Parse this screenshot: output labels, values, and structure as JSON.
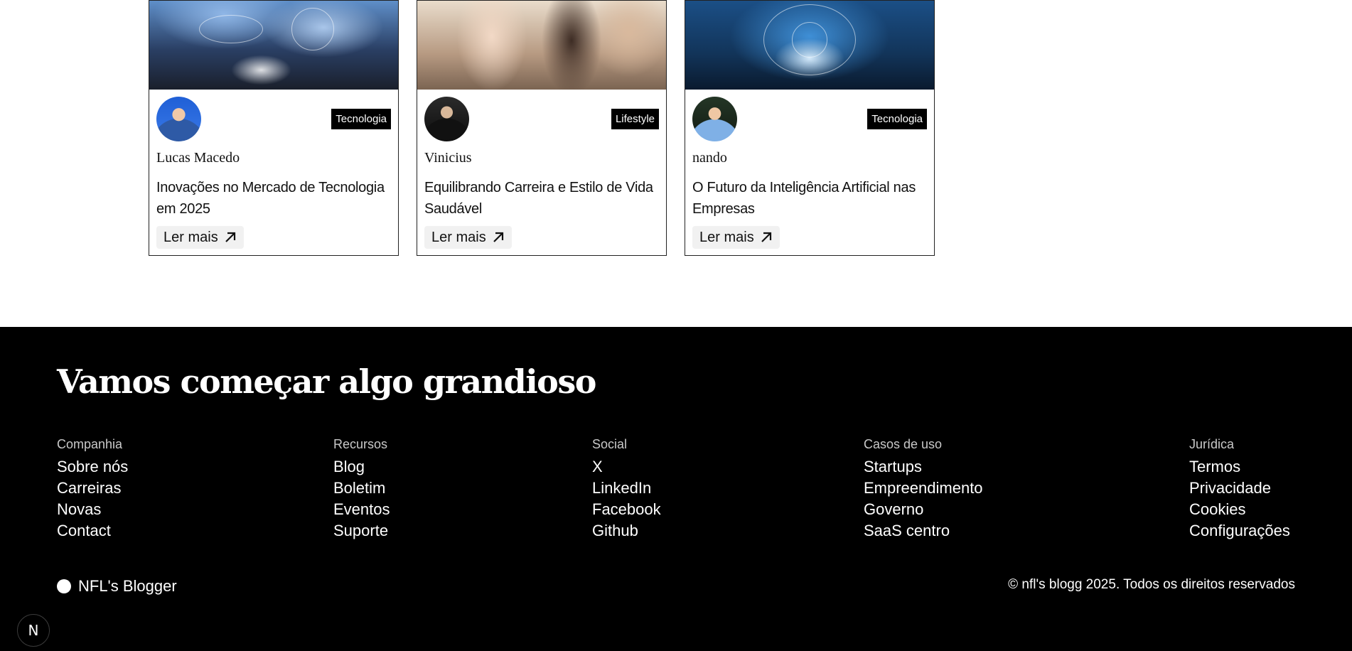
{
  "cards": [
    {
      "category": "Tecnologia",
      "author": "Lucas Macedo",
      "title": "Inovações no Mercado de Tecnologia em 2025",
      "read_more": "Ler mais"
    },
    {
      "category": "Lifestyle",
      "author": "Vinicius",
      "title": "Equilibrando Carreira e Estilo de Vida Saudável",
      "read_more": "Ler mais"
    },
    {
      "category": "Tecnologia",
      "author": "nando",
      "title": "O Futuro da Inteligência Artificial nas Empresas",
      "read_more": "Ler mais"
    }
  ],
  "footer": {
    "headline": "Vamos começar algo grandioso",
    "columns": [
      {
        "heading": "Companhia",
        "links": [
          "Sobre nós",
          "Carreiras",
          "Novas",
          "Contact"
        ]
      },
      {
        "heading": "Recursos",
        "links": [
          "Blog",
          "Boletim",
          "Eventos",
          "Suporte"
        ]
      },
      {
        "heading": "Social",
        "links": [
          "X",
          "LinkedIn",
          "Facebook",
          "Github"
        ]
      },
      {
        "heading": "Casos de uso",
        "links": [
          "Startups",
          "Empreendimento",
          "Governo",
          "SaaS centro"
        ]
      },
      {
        "heading": "Jurídica",
        "links": [
          "Termos",
          "Privacidade",
          "Cookies",
          "Configurações"
        ]
      }
    ],
    "brand": "NFL's Blogger",
    "copyright": "© nfl's blogg 2025. Todos os direitos reservados",
    "badge": "N"
  },
  "colors": {
    "footer_bg": "#000000",
    "tag_bg": "#000000",
    "read_more_bg": "#f1f1f1"
  }
}
